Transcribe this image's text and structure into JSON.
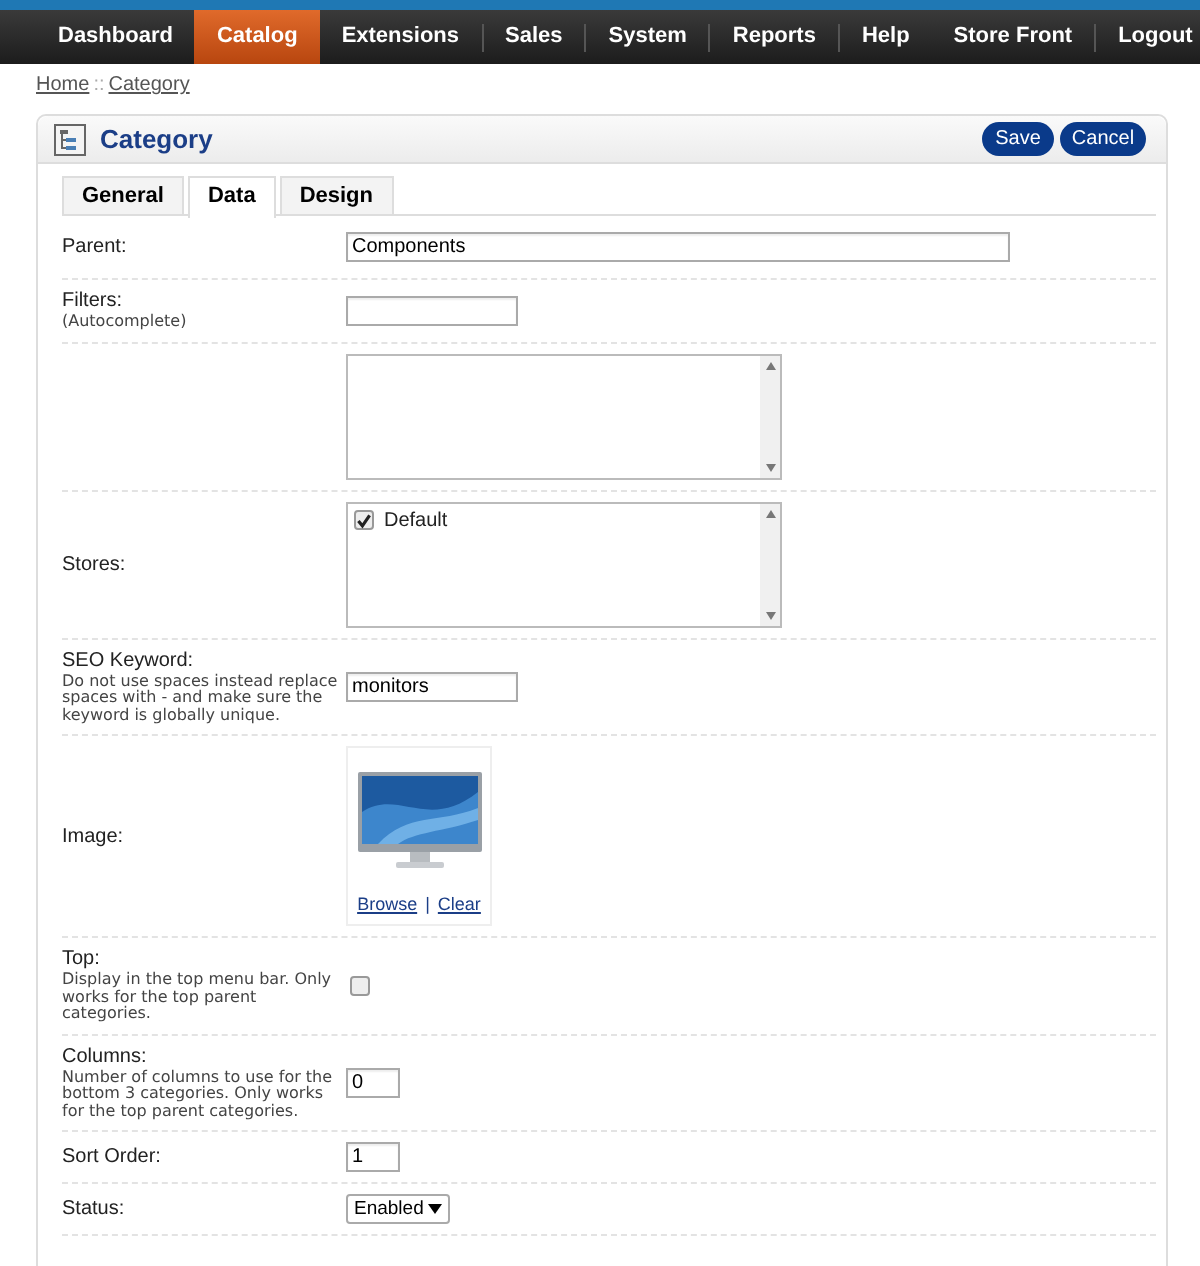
{
  "nav": {
    "left": [
      {
        "label": "Dashboard",
        "selected": false
      },
      {
        "label": "Catalog",
        "selected": true
      },
      {
        "label": "Extensions",
        "selected": false
      },
      {
        "label": "Sales",
        "selected": false
      },
      {
        "label": "System",
        "selected": false
      },
      {
        "label": "Reports",
        "selected": false
      },
      {
        "label": "Help",
        "selected": false
      }
    ],
    "right": [
      "Store Front",
      "Logout"
    ]
  },
  "breadcrumb": {
    "links": [
      "Home",
      "Category"
    ],
    "separator": "::"
  },
  "panel": {
    "title": "Category",
    "buttons": [
      "Save",
      "Cancel"
    ]
  },
  "tabs": [
    {
      "label": "General",
      "selected": false
    },
    {
      "label": "Data",
      "selected": true
    },
    {
      "label": "Design",
      "selected": false
    }
  ],
  "rows": [
    {
      "kind": "longtext",
      "label": "Parent:",
      "value": "Components"
    },
    {
      "kind": "text",
      "label": "Filters:",
      "help": "(Autocomplete)"
    },
    {
      "kind": "list"
    },
    {
      "kind": "list",
      "label": "Stores:",
      "items": [
        {
          "label": "Default",
          "checked": true
        }
      ]
    },
    {
      "kind": "text",
      "label": "SEO Keyword:",
      "help": "Do not use spaces instead replace spaces with - and make sure the keyword is globally unique.",
      "value": "monitors"
    },
    {
      "label": "Image:",
      "links": [
        "Browse",
        "Clear"
      ],
      "separator": "|"
    },
    {
      "kind": "checkbox",
      "label": "Top:",
      "help": "Display in the top menu bar. Only works for the top parent categories.",
      "checked": false
    },
    {
      "kind": "number",
      "label": "Columns:",
      "help": "Number of columns to use for the bottom 3 categories. Only works for the top parent categories.",
      "value": "0"
    },
    {
      "kind": "number",
      "label": "Sort Order:",
      "value": "1"
    },
    {
      "kind": "select",
      "label": "Status:",
      "value": "Enabled"
    }
  ]
}
